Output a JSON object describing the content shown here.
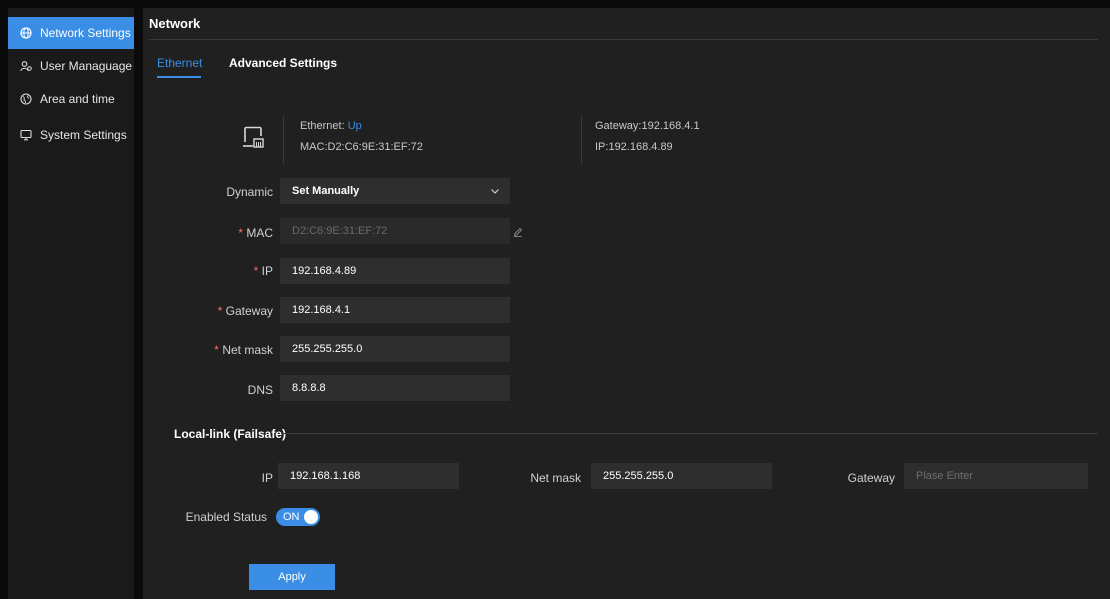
{
  "sidebar": {
    "items": [
      {
        "label": "Network Settings",
        "icon": "globe-icon"
      },
      {
        "label": "User Managuage",
        "icon": "users-icon"
      },
      {
        "label": "Area and time",
        "icon": "globe-clock-icon"
      },
      {
        "label": "System Settings",
        "icon": "monitor-icon"
      }
    ]
  },
  "page": {
    "title": "Network"
  },
  "tabs": [
    {
      "label": "Ethernet",
      "active": true
    },
    {
      "label": "Advanced Settings",
      "active": false
    }
  ],
  "status": {
    "ethernet_label": "Ethernet:",
    "ethernet_state": "Up",
    "mac": "MAC:D2:C6:9E:31:EF:72",
    "gateway": "Gateway:192.168.4.1",
    "ip": "IP:192.168.4.89"
  },
  "form": {
    "dynamic": {
      "label": "Dynamic",
      "value": "Set Manually"
    },
    "mac": {
      "label": "MAC",
      "value": "D2:C6:9E:31:EF:72"
    },
    "ip": {
      "label": "IP",
      "value": "192.168.4.89"
    },
    "gateway": {
      "label": "Gateway",
      "value": "192.168.4.1"
    },
    "netmask": {
      "label": "Net mask",
      "value": "255.255.255.0"
    },
    "dns": {
      "label": "DNS",
      "value": "8.8.8.8"
    },
    "required_mark": "*"
  },
  "local_link": {
    "title": "Local-link (Failsafe)",
    "ip": {
      "label": "IP",
      "value": "192.168.1.168"
    },
    "netmask": {
      "label": "Net mask",
      "value": "255.255.255.0"
    },
    "gateway": {
      "label": "Gateway",
      "placeholder": "Plase Enter"
    },
    "enabled": {
      "label": "Enabled Status",
      "state": "ON"
    }
  },
  "actions": {
    "apply": "Apply"
  },
  "colors": {
    "accent": "#3a8ee6",
    "required": "#f56c6c",
    "panel": "#202020",
    "sidebar": "#1a1a1a"
  }
}
